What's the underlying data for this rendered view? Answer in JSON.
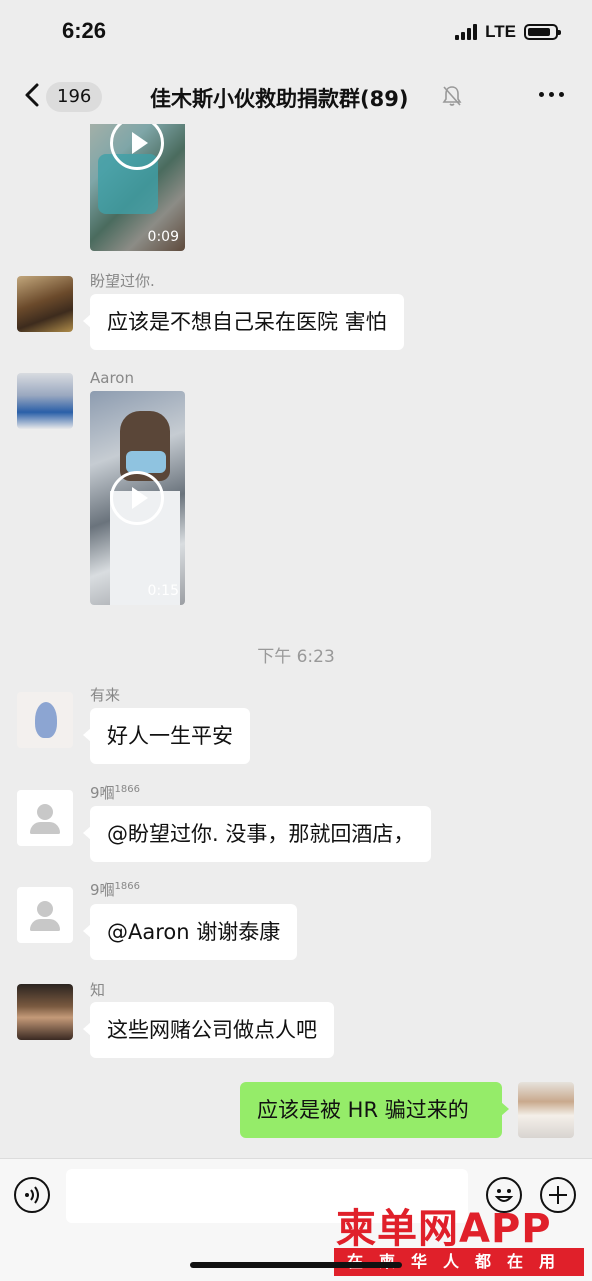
{
  "status": {
    "time": "6:26",
    "network": "LTE",
    "battery_level": 0.8
  },
  "nav": {
    "back_count": "196",
    "title": "佳木斯小伙救助捐款群(89)"
  },
  "messages": {
    "video1": {
      "duration": "0:09"
    },
    "msg2": {
      "sender": "盼望过你.",
      "text": "应该是不想自己呆在医院 害怕"
    },
    "msg3": {
      "sender": "Aaron",
      "duration": "0:15"
    },
    "timestamp": "下午 6:23",
    "msg4": {
      "sender": "有来",
      "text": "好人一生平安"
    },
    "msg5": {
      "sender": "9嗰",
      "sender_sup": "1866",
      "text": "@盼望过你. 没事，那就回酒店，"
    },
    "msg6": {
      "sender": "9嗰",
      "sender_sup": "1866",
      "text": "@Aaron 谢谢泰康"
    },
    "msg7": {
      "sender": "知",
      "text": "这些网赌公司做点人吧"
    },
    "msg8": {
      "text": "应该是被 HR 骗过来的"
    }
  },
  "watermark": {
    "main": "柬单网APP",
    "sub": "在柬华人都在用"
  },
  "icons": [
    "back-icon",
    "mute-icon",
    "more-icon",
    "voice-icon",
    "emoji-icon",
    "add-icon",
    "play-icon"
  ]
}
